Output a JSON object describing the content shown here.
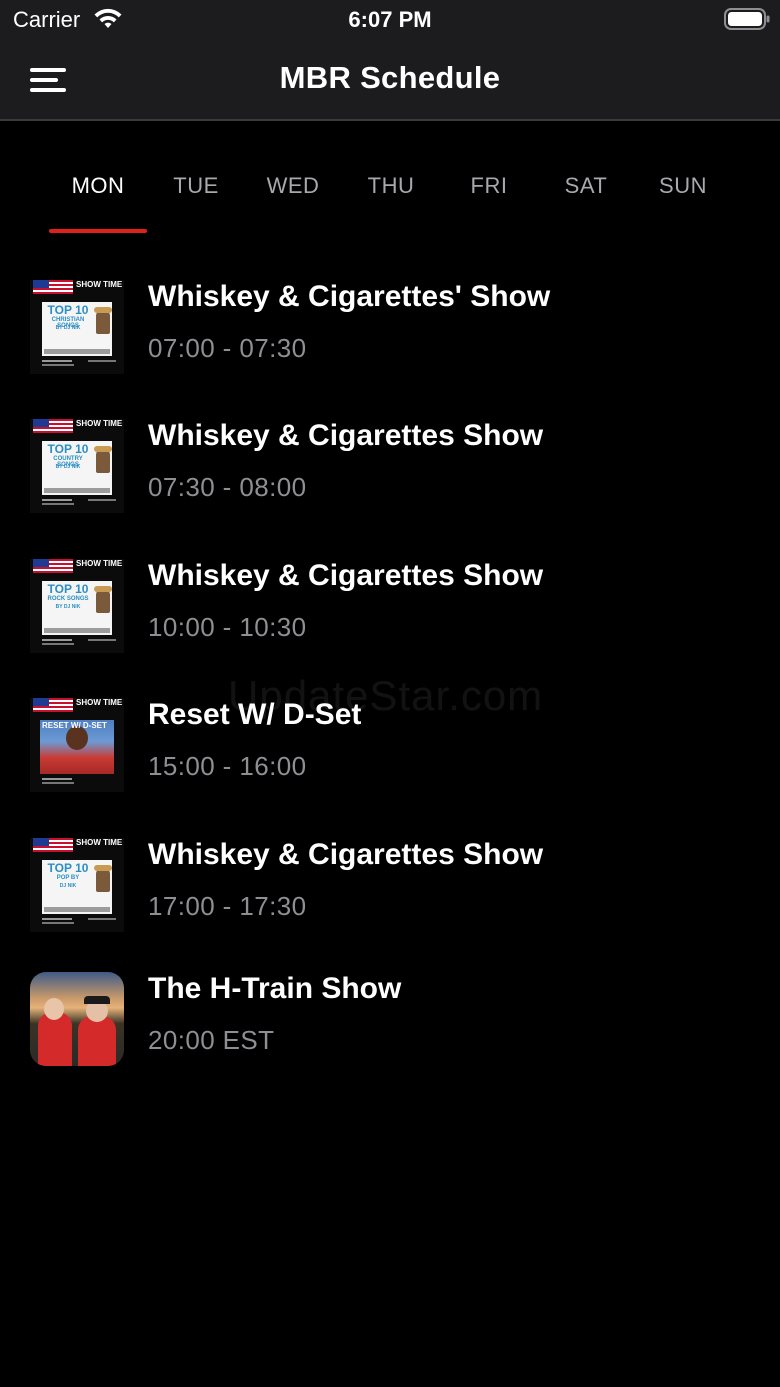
{
  "status_bar": {
    "carrier": "Carrier",
    "time": "6:07 PM"
  },
  "nav": {
    "title": "MBR Schedule"
  },
  "tabs": [
    {
      "label": "MON",
      "active": true
    },
    {
      "label": "TUE",
      "active": false
    },
    {
      "label": "WED",
      "active": false
    },
    {
      "label": "THU",
      "active": false
    },
    {
      "label": "FRI",
      "active": false
    },
    {
      "label": "SAT",
      "active": false
    },
    {
      "label": "SUN",
      "active": false
    }
  ],
  "schedule": [
    {
      "title": "Whiskey & Cigarettes' Show",
      "time": "07:00 - 07:30",
      "thumb": {
        "kind": "promo",
        "showtime": "SHOW TIME",
        "headline": "TOP 10",
        "genre": "CHRISTIAN SONGS",
        "by": "BY DJ NIK"
      }
    },
    {
      "title": "Whiskey & Cigarettes Show",
      "time": "07:30 - 08:00",
      "thumb": {
        "kind": "promo",
        "showtime": "SHOW TIME",
        "headline": "TOP 10",
        "genre": "COUNTRY SONGS",
        "by": "BY DJ NIK"
      }
    },
    {
      "title": "Whiskey & Cigarettes Show",
      "time": "10:00 - 10:30",
      "thumb": {
        "kind": "promo",
        "showtime": "SHOW TIME",
        "headline": "TOP 10",
        "genre": "ROCK SONGS",
        "by": "BY DJ NIK"
      }
    },
    {
      "title": "Reset W/ D-Set",
      "time": "15:00 - 16:00",
      "thumb": {
        "kind": "photo-promo",
        "showtime": "SHOW TIME",
        "headline": "RESET W/ D-SET"
      }
    },
    {
      "title": "Whiskey & Cigarettes Show",
      "time": "17:00 - 17:30",
      "thumb": {
        "kind": "promo",
        "showtime": "SHOW TIME",
        "headline": "TOP 10",
        "genre": "POP BY",
        "by": "DJ NIK"
      }
    },
    {
      "title": "The H-Train Show",
      "time": "20:00 EST",
      "thumb": {
        "kind": "photo"
      }
    }
  ],
  "watermark": "UpdateStar.com",
  "colors": {
    "accent": "#e1201a",
    "background": "#000000",
    "bar": "#1c1c1e",
    "secondary_text": "#8e8e93"
  }
}
